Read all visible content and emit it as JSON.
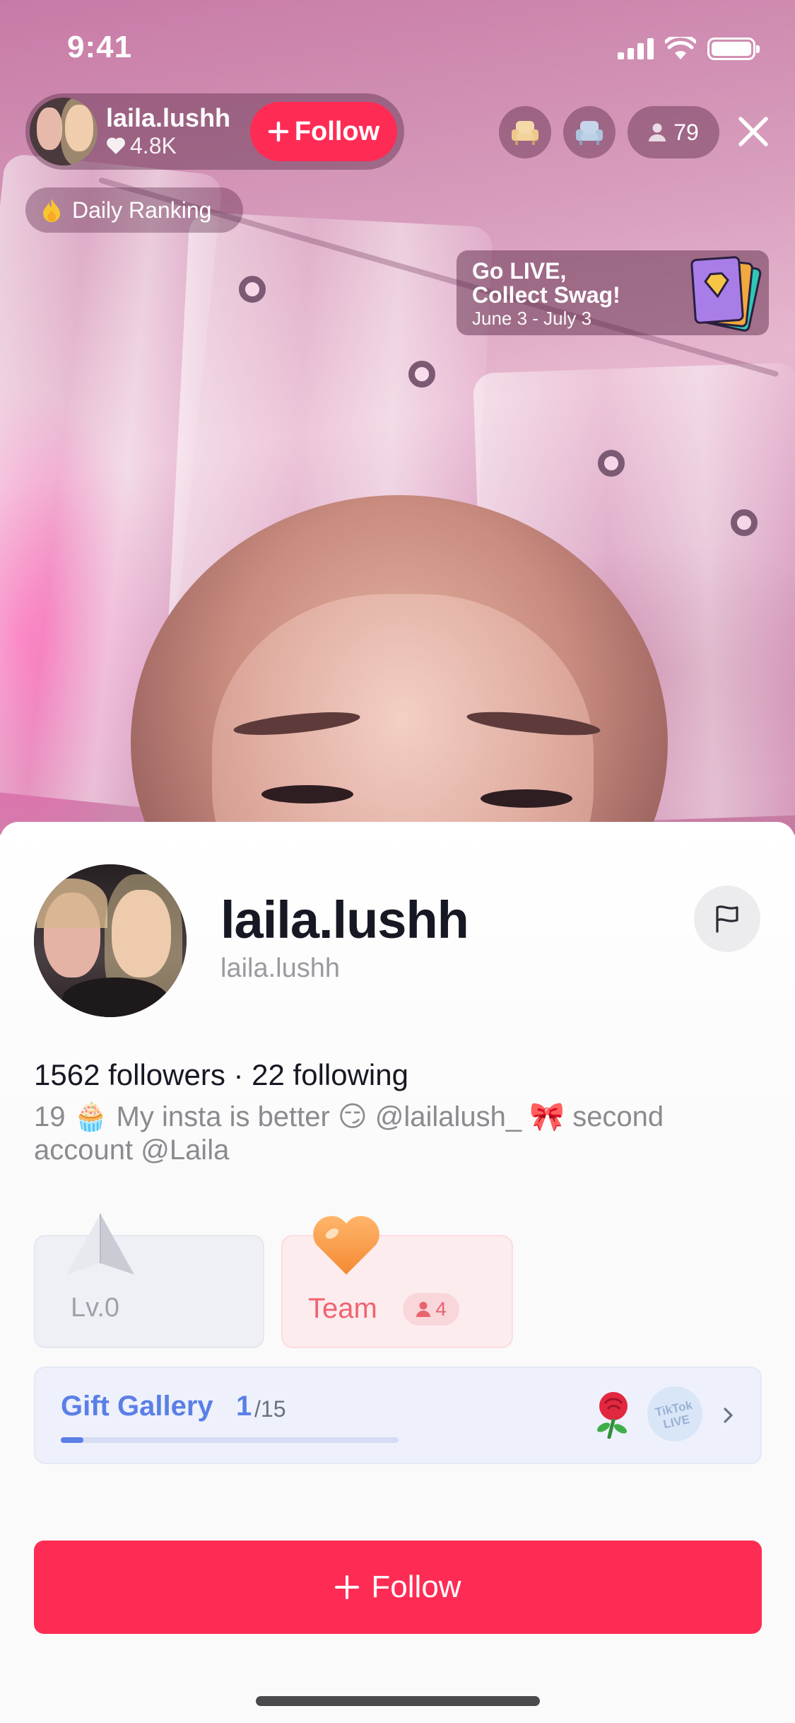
{
  "status_bar": {
    "time": "9:41"
  },
  "host": {
    "name": "laila.lushh",
    "likes": "4.8K",
    "follow_label": "Follow",
    "viewer_count": "79"
  },
  "ranking": {
    "label": "Daily Ranking"
  },
  "promo": {
    "line1": "Go LIVE,",
    "line2": "Collect Swag!",
    "dates": "June 3 - July 3"
  },
  "profile": {
    "display_name": "laila.lushh",
    "username": "laila.lushh",
    "counts": "1562 followers · 22 following",
    "bio": "19 🧁 My insta is better 😏 @lailalush_ 🎀 second account @Laila"
  },
  "level_card": {
    "label": "Lv.0"
  },
  "team_card": {
    "label": "Team",
    "count": "4"
  },
  "gift_gallery": {
    "title": "Gift Gallery",
    "collected": "1",
    "total": "/15",
    "progress": 0.067,
    "badge_text": "TikTok LIVE"
  },
  "follow_button": {
    "label": "Follow"
  },
  "colors": {
    "accent": "#fe2c55",
    "gallery_blue": "#5a7fe6",
    "team_red": "#f0636f"
  }
}
